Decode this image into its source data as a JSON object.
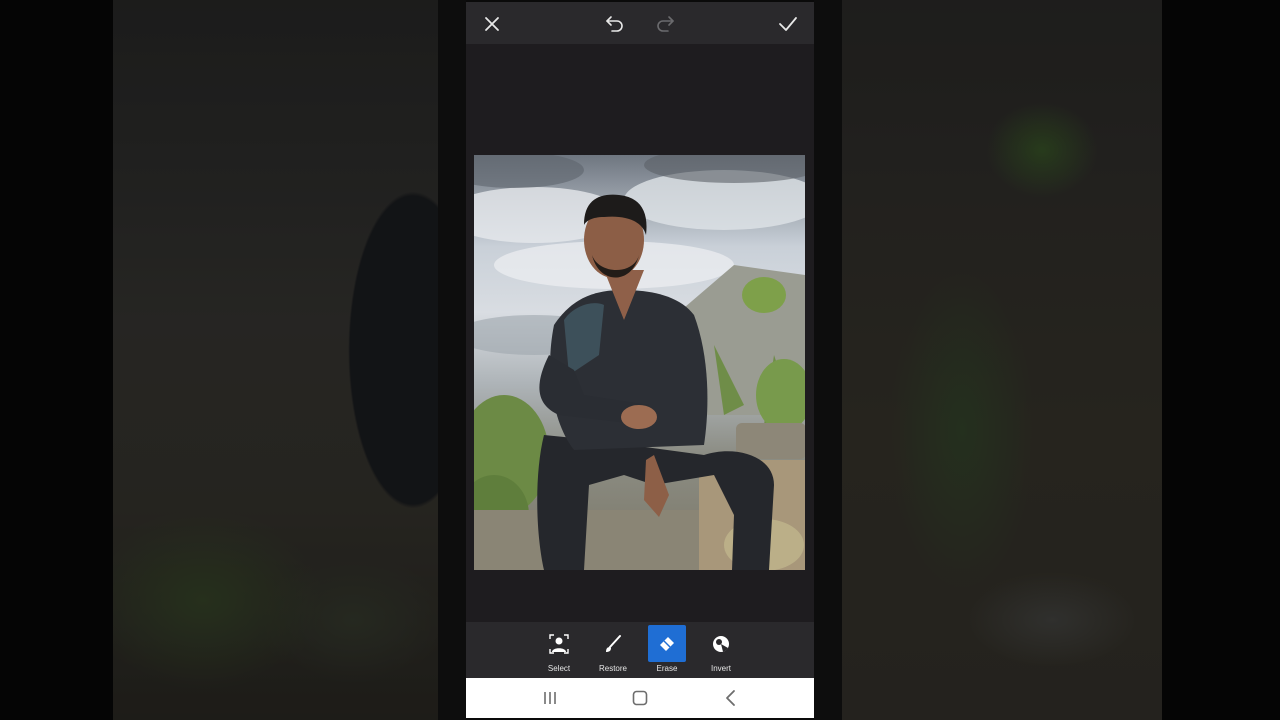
{
  "app": {
    "top_bar": {
      "close_icon": "close-icon",
      "undo_icon": "undo-icon",
      "redo_icon": "redo-icon",
      "apply_icon": "checkmark-icon"
    },
    "tools": [
      {
        "label": "Select",
        "icon": "person-select-icon",
        "active": false
      },
      {
        "label": "Restore",
        "icon": "brush-icon",
        "active": false
      },
      {
        "label": "Erase",
        "icon": "eraser-icon",
        "active": true
      },
      {
        "label": "Invert",
        "icon": "invert-icon",
        "active": false
      }
    ],
    "nav_bar": {
      "recents_icon": "recents-icon",
      "home_icon": "home-icon",
      "back_icon": "back-icon"
    },
    "colors": {
      "accent": "#1f6ed4",
      "toolbar_bg": "#2a292c",
      "canvas_bg": "#1e1c1f"
    }
  }
}
